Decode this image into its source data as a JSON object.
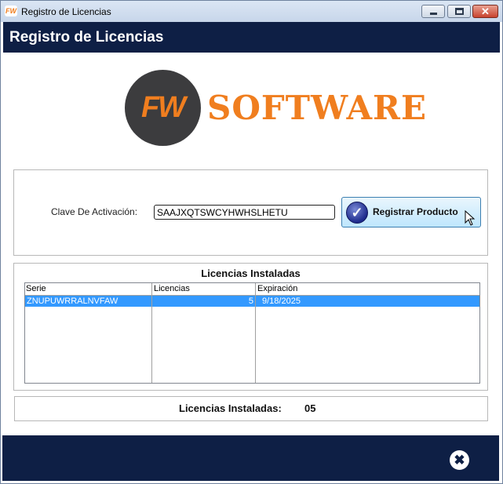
{
  "window": {
    "title": "Registro de Licencias",
    "app_icon_text": "FW",
    "controls": {
      "minimize_icon": "minimize-icon",
      "maximize_icon": "maximize-icon",
      "close_glyph": "✕"
    }
  },
  "header": {
    "title": "Registro de Licencias",
    "background": "#0e1f45"
  },
  "logo": {
    "monogram": "FW",
    "wordmark": "SOFTWARE",
    "accent": "#f07e1f",
    "circle": "#3c3c3e"
  },
  "activation": {
    "label": "Clave De Activación:",
    "key_value": "SAAJXQTSWCYHWHSLHETU",
    "register_button_label": "Registrar Producto",
    "register_icon": "check-circle-icon"
  },
  "installed": {
    "title": "Licencias Instaladas",
    "columns": [
      "Serie",
      "Licencias",
      "Expiración"
    ],
    "rows": [
      {
        "serie": "ZNUPUWRRALNVFAW",
        "licencias": "5",
        "expiracion": "9/18/2025",
        "selected": true
      }
    ]
  },
  "summary": {
    "label": "Licencias Instaladas:",
    "value": "05"
  },
  "footer": {
    "exit_icon": "close-circle-icon",
    "exit_glyph": "✖"
  }
}
